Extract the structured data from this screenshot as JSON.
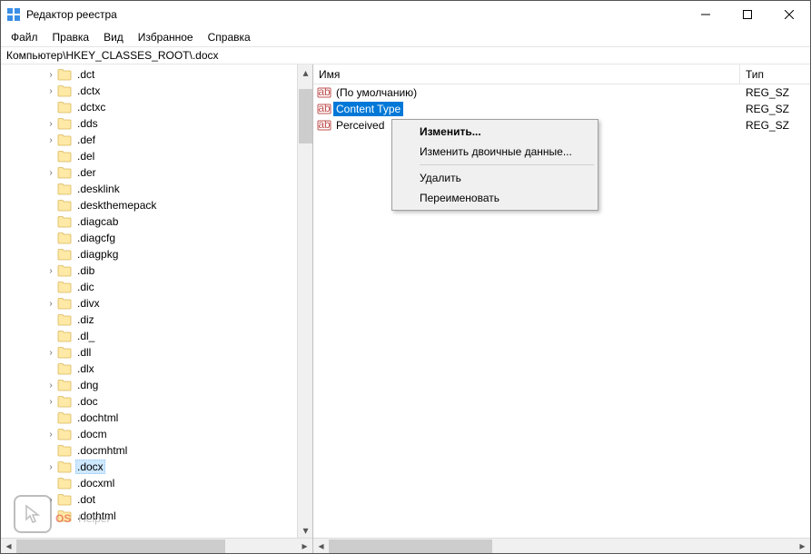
{
  "window": {
    "title": "Редактор реестра"
  },
  "menu": {
    "file": "Файл",
    "edit": "Правка",
    "view": "Вид",
    "favorites": "Избранное",
    "help": "Справка"
  },
  "address": "Компьютер\\HKEY_CLASSES_ROOT\\.docx",
  "list": {
    "col_name": "Имя",
    "col_type": "Тип",
    "rows": [
      {
        "name": "(По умолчанию)",
        "type": "REG_SZ",
        "selected": false
      },
      {
        "name": "Content Type",
        "type": "REG_SZ",
        "selected": true
      },
      {
        "name": "PerceivedType",
        "type": "REG_SZ",
        "selected": false,
        "display_name": "Perceived"
      }
    ]
  },
  "context_menu": {
    "modify": "Изменить...",
    "modify_binary": "Изменить двоичные данные...",
    "delete": "Удалить",
    "rename": "Переименовать"
  },
  "tree": [
    {
      "label": ".dct",
      "exp": "closed",
      "indent": 3
    },
    {
      "label": ".dctx",
      "exp": "closed",
      "indent": 3
    },
    {
      "label": ".dctxc",
      "exp": "none",
      "indent": 3
    },
    {
      "label": ".dds",
      "exp": "closed",
      "indent": 3
    },
    {
      "label": ".def",
      "exp": "closed",
      "indent": 3
    },
    {
      "label": ".del",
      "exp": "none",
      "indent": 3
    },
    {
      "label": ".der",
      "exp": "closed",
      "indent": 3
    },
    {
      "label": ".desklink",
      "exp": "none",
      "indent": 3
    },
    {
      "label": ".deskthemepack",
      "exp": "none",
      "indent": 3
    },
    {
      "label": ".diagcab",
      "exp": "none",
      "indent": 3
    },
    {
      "label": ".diagcfg",
      "exp": "none",
      "indent": 3
    },
    {
      "label": ".diagpkg",
      "exp": "none",
      "indent": 3
    },
    {
      "label": ".dib",
      "exp": "closed",
      "indent": 3
    },
    {
      "label": ".dic",
      "exp": "none",
      "indent": 3
    },
    {
      "label": ".divx",
      "exp": "closed",
      "indent": 3
    },
    {
      "label": ".diz",
      "exp": "none",
      "indent": 3
    },
    {
      "label": ".dl_",
      "exp": "none",
      "indent": 3
    },
    {
      "label": ".dll",
      "exp": "closed",
      "indent": 3
    },
    {
      "label": ".dlx",
      "exp": "none",
      "indent": 3
    },
    {
      "label": ".dng",
      "exp": "closed",
      "indent": 3
    },
    {
      "label": ".doc",
      "exp": "closed",
      "indent": 3
    },
    {
      "label": ".dochtml",
      "exp": "none",
      "indent": 3
    },
    {
      "label": ".docm",
      "exp": "closed",
      "indent": 3
    },
    {
      "label": ".docmhtml",
      "exp": "none",
      "indent": 3
    },
    {
      "label": ".docx",
      "exp": "closed",
      "indent": 3,
      "selected": true
    },
    {
      "label": ".docxml",
      "exp": "none",
      "indent": 3
    },
    {
      "label": ".dot",
      "exp": "closed",
      "indent": 3
    },
    {
      "label": ".dothtml",
      "exp": "none",
      "indent": 3
    }
  ],
  "watermark": {
    "os": "OS",
    "helper": "Helper"
  }
}
